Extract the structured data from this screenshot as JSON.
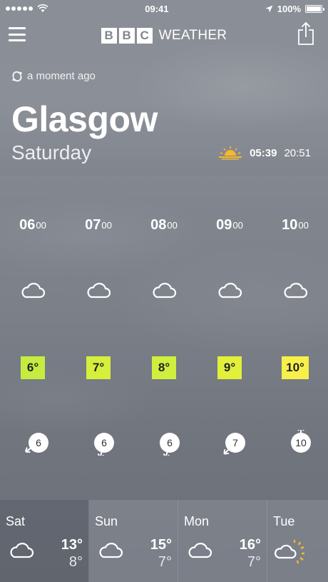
{
  "status_bar": {
    "time": "09:41",
    "battery": "100%"
  },
  "header": {
    "brand_letters": [
      "B",
      "B",
      "C"
    ],
    "brand_word": "WEATHER"
  },
  "location": {
    "updated": "a moment ago",
    "city": "Glasgow",
    "day": "Saturday",
    "sunrise": "05:39",
    "sunset": "20:51"
  },
  "hourly": [
    {
      "hour": "06",
      "minutes": "00",
      "icon": "cloud-icon",
      "temp": "6°",
      "color": "#c6ec3f",
      "wind": "6",
      "wind_angle": -35
    },
    {
      "hour": "07",
      "minutes": "00",
      "icon": "cloud-icon",
      "temp": "7°",
      "color": "#d6ee3c",
      "wind": "6",
      "wind_angle": -75
    },
    {
      "hour": "08",
      "minutes": "00",
      "icon": "cloud-icon",
      "temp": "8°",
      "color": "#cfee3d",
      "wind": "6",
      "wind_angle": -75
    },
    {
      "hour": "09",
      "minutes": "00",
      "icon": "cloud-icon",
      "temp": "9°",
      "color": "#e2f03a",
      "wind": "7",
      "wind_angle": -45
    },
    {
      "hour": "10",
      "minutes": "00",
      "icon": "cloud-icon",
      "temp": "10°",
      "color": "#f7f04a",
      "wind": "10",
      "wind_angle": 0
    }
  ],
  "daily": [
    {
      "name": "Sat",
      "icon": "cloud-icon",
      "high": "13°",
      "low": "8°"
    },
    {
      "name": "Sun",
      "icon": "cloud-icon",
      "high": "15°",
      "low": "7°"
    },
    {
      "name": "Mon",
      "icon": "cloud-icon",
      "high": "16°",
      "low": "7°"
    },
    {
      "name": "Tue",
      "icon": "sun-cloud-icon"
    }
  ]
}
